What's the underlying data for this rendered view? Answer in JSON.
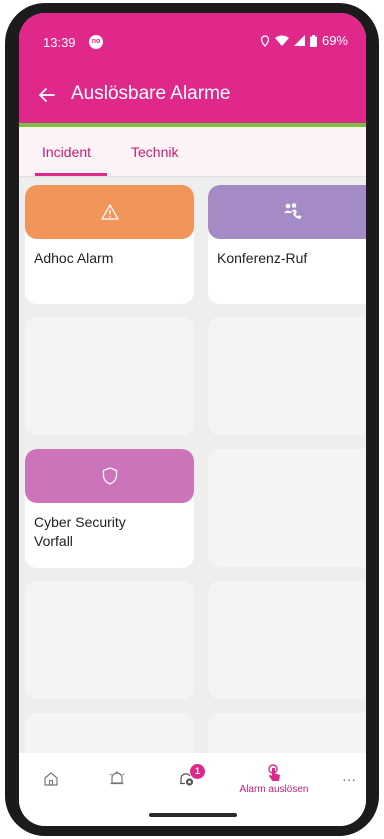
{
  "status_bar": {
    "time": "13:39",
    "notification_badge": "no",
    "battery": "69%"
  },
  "app_bar": {
    "title": "Auslösbare Alarme"
  },
  "tabs": [
    {
      "label": "Incident",
      "active": true
    },
    {
      "label": "Technik",
      "active": false
    }
  ],
  "cards": [
    {
      "label": "Adhoc Alarm",
      "color": "#f2955a",
      "icon": "warning-icon"
    },
    {
      "label": "Konferenz-Ruf",
      "color": "#a48bc6",
      "icon": "conference-call-icon"
    },
    {
      "label": "",
      "color": "",
      "icon": ""
    },
    {
      "label": "",
      "color": "",
      "icon": ""
    },
    {
      "label": "Cyber Security Vorfall",
      "color": "#cc73b9",
      "icon": "shield-icon"
    },
    {
      "label": "",
      "color": "",
      "icon": ""
    }
  ],
  "bottom_nav": {
    "home_icon": "home-icon",
    "bell_icon": "bell-icon",
    "badge_count": "1",
    "alarm_label": "Alarm auslösen",
    "more": "···"
  },
  "colors": {
    "brand": "#e0278a",
    "accent_green": "#7ac143"
  }
}
